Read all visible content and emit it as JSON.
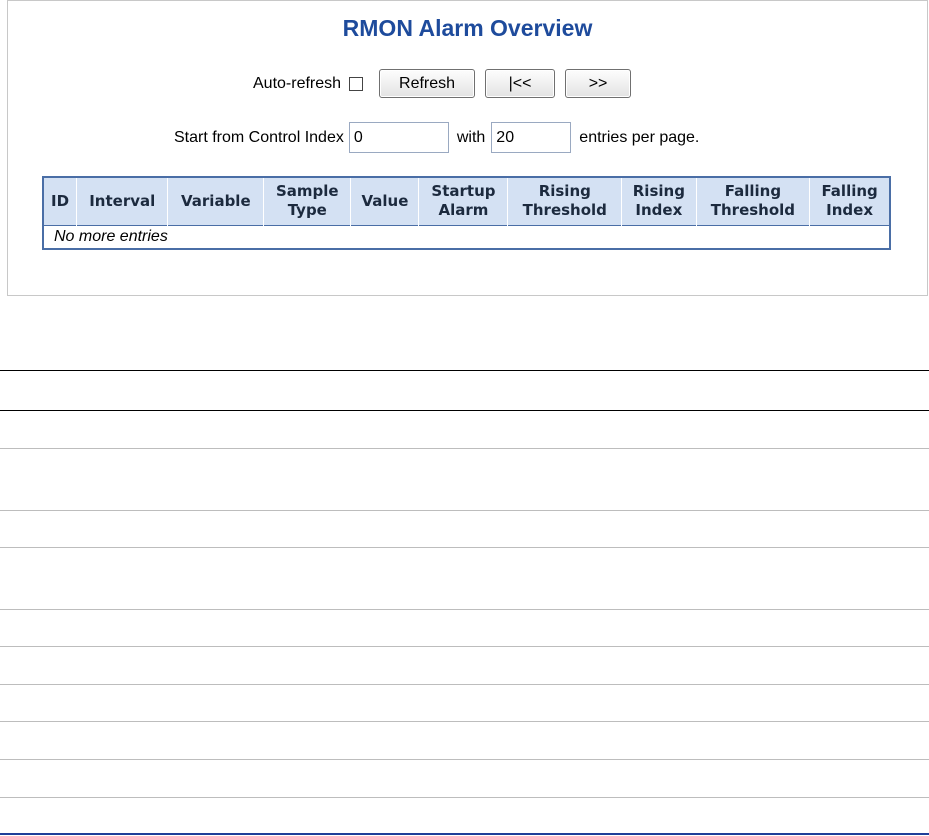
{
  "panel": {
    "title": "RMON Alarm Overview",
    "auto_refresh_label": "Auto-refresh",
    "auto_refresh_checked": false,
    "buttons": {
      "refresh": "Refresh",
      "first": "|<<",
      "next": ">>"
    },
    "index_row": {
      "prefix": "Start from Control Index",
      "index_value": "0",
      "with_label": "with",
      "count_value": "20",
      "suffix": "entries per page."
    }
  },
  "table": {
    "headers": [
      [
        "ID"
      ],
      [
        "Interval"
      ],
      [
        "Variable"
      ],
      [
        "Sample",
        "Type"
      ],
      [
        "Value"
      ],
      [
        "Startup",
        "Alarm"
      ],
      [
        "Rising",
        "Threshold"
      ],
      [
        "Rising",
        "Index"
      ],
      [
        "Falling",
        "Threshold"
      ],
      [
        "Falling",
        "Index"
      ]
    ],
    "empty_message": "No more entries"
  },
  "colors": {
    "title": "#1e4b9c",
    "header_bg": "#d4e1f3",
    "table_border": "#4a6ea6"
  }
}
